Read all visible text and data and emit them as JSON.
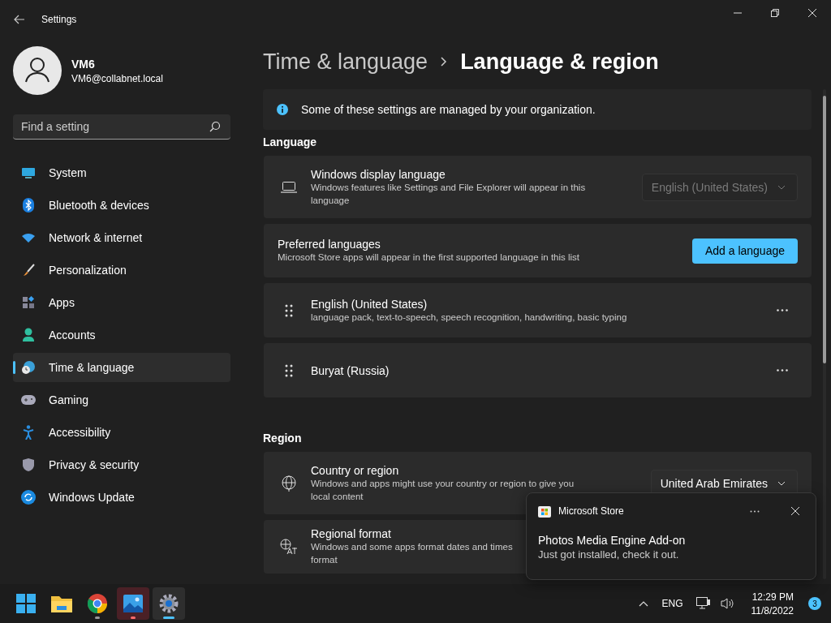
{
  "window": {
    "title": "Settings"
  },
  "profile": {
    "name": "VM6",
    "email": "VM6@collabnet.local"
  },
  "search": {
    "placeholder": "Find a setting"
  },
  "nav": [
    {
      "label": "System",
      "selected": false
    },
    {
      "label": "Bluetooth & devices",
      "selected": false
    },
    {
      "label": "Network & internet",
      "selected": false
    },
    {
      "label": "Personalization",
      "selected": false
    },
    {
      "label": "Apps",
      "selected": false
    },
    {
      "label": "Accounts",
      "selected": false
    },
    {
      "label": "Time & language",
      "selected": true
    },
    {
      "label": "Gaming",
      "selected": false
    },
    {
      "label": "Accessibility",
      "selected": false
    },
    {
      "label": "Privacy & security",
      "selected": false
    },
    {
      "label": "Windows Update",
      "selected": false
    }
  ],
  "breadcrumb": {
    "parent": "Time & language",
    "current": "Language & region"
  },
  "info_bar": {
    "text": "Some of these settings are managed by your organization."
  },
  "sections": [
    {
      "title": "Language",
      "cards": [
        {
          "kind": "dropdown",
          "title": "Windows display language",
          "description_lines": [
            "Windows features like Settings and File Explorer will appear in this",
            "language"
          ],
          "value": "English (United States)",
          "disabled": true
        },
        {
          "kind": "button",
          "title": "Preferred languages",
          "description": "Microsoft Store apps will appear in the first supported language in this list",
          "button": "Add a language"
        },
        {
          "kind": "language",
          "title": "English (United States)",
          "description": "language pack, text-to-speech, speech recognition, handwriting, basic typing"
        },
        {
          "kind": "language",
          "title": "Buryat (Russia)"
        }
      ]
    },
    {
      "title": "Region",
      "cards": [
        {
          "kind": "dropdown",
          "title": "Country or region",
          "description_lines": [
            "Windows and apps might use your country or region to give you",
            "local content"
          ],
          "value": "United Arab Emirates",
          "disabled": false
        },
        {
          "kind": "plain",
          "title": "Regional format",
          "description_lines": [
            "Windows and some apps format dates and times",
            "format"
          ]
        }
      ]
    }
  ],
  "toast": {
    "app": "Microsoft Store",
    "title": "Photos Media Engine Add-on",
    "body": "Just got installed, check it out."
  },
  "taskbar": {
    "apps": [
      {
        "running": false,
        "active": false
      },
      {
        "running": false,
        "active": false
      },
      {
        "running": true,
        "active": false
      },
      {
        "running": true,
        "active": false,
        "alert": true
      },
      {
        "running": true,
        "active": true
      }
    ],
    "language": "ENG",
    "time": "12:29 PM",
    "date": "11/8/2022",
    "notifications": "3"
  }
}
